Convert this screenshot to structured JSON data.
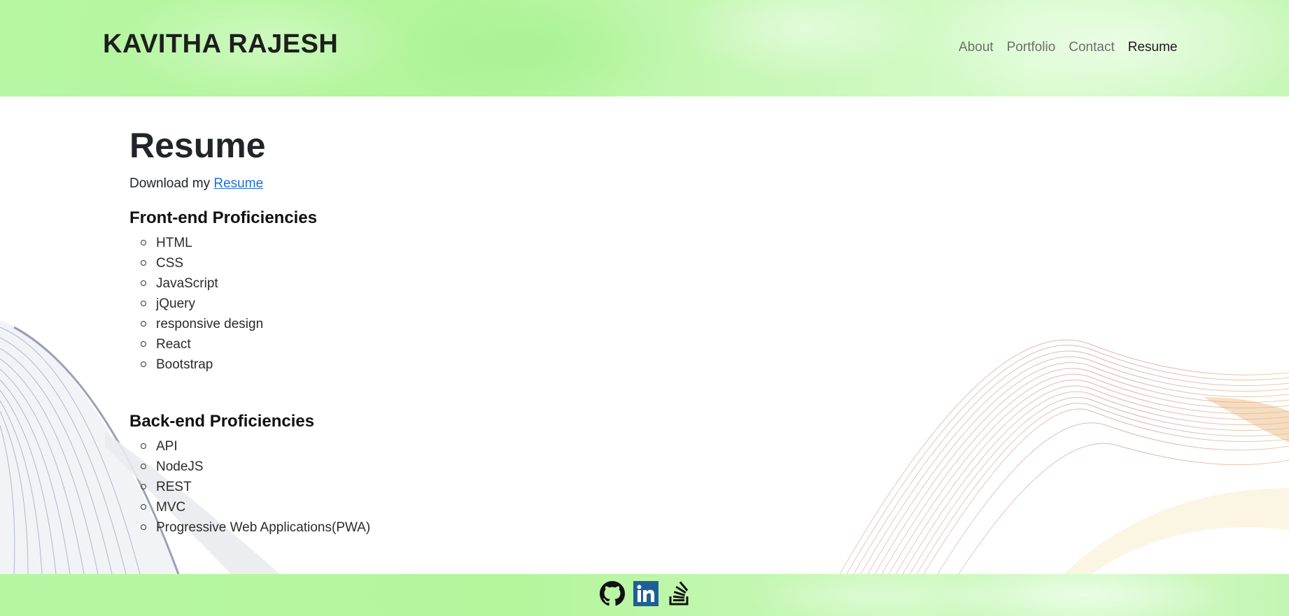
{
  "header": {
    "brand": "KAVITHA RAJESH",
    "nav": [
      {
        "label": "About"
      },
      {
        "label": "Portfolio"
      },
      {
        "label": "Contact"
      },
      {
        "label": "Resume"
      }
    ],
    "active_nav": "Resume"
  },
  "main": {
    "title": "Resume",
    "download_prefix": "Download my ",
    "download_link": "Resume",
    "frontend": {
      "heading": "Front-end Proficiencies",
      "items": [
        "HTML",
        "CSS",
        "JavaScript",
        "jQuery",
        "responsive design",
        "React",
        "Bootstrap"
      ]
    },
    "backend": {
      "heading": "Back-end Proficiencies",
      "items": [
        "API",
        "NodeJS",
        "REST",
        "MVC",
        "Progressive Web Applications(PWA)"
      ]
    }
  },
  "footer": {
    "social": [
      {
        "name": "github-icon"
      },
      {
        "name": "linkedin-icon"
      },
      {
        "name": "stackoverflow-icon"
      }
    ]
  },
  "colors": {
    "header_green": "#b7f7a4",
    "link_blue": "#1e6fd9",
    "linkedin_blue": "#1f5f99"
  }
}
